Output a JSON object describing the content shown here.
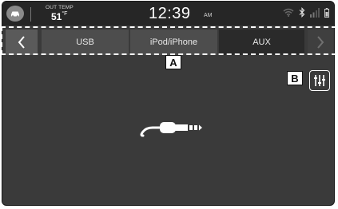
{
  "status": {
    "temp_label": "OUT TEMP",
    "temp_value": "51",
    "temp_unit": "°F",
    "time": "12:39",
    "ampm": "AM"
  },
  "tabs": {
    "prev_icon": "chevron-left-icon",
    "next_icon": "chevron-right-icon",
    "items": [
      {
        "label": "USB",
        "active": false
      },
      {
        "label": "iPod/iPhone",
        "active": false
      },
      {
        "label": "AUX",
        "active": true
      }
    ]
  },
  "callouts": {
    "a": "A",
    "b": "B"
  },
  "icons": {
    "home": "car-home-icon",
    "wifi": "wifi-icon",
    "bluetooth": "bluetooth-icon",
    "signal": "signal-icon",
    "battery": "battery-icon",
    "equalizer": "equalizer-icon",
    "aux": "aux-cable-icon"
  },
  "colors": {
    "background": "#3a3a3a",
    "statusbar": "#262626",
    "tab": "#4d4d4d",
    "tab_active": "#2a2a2a"
  }
}
